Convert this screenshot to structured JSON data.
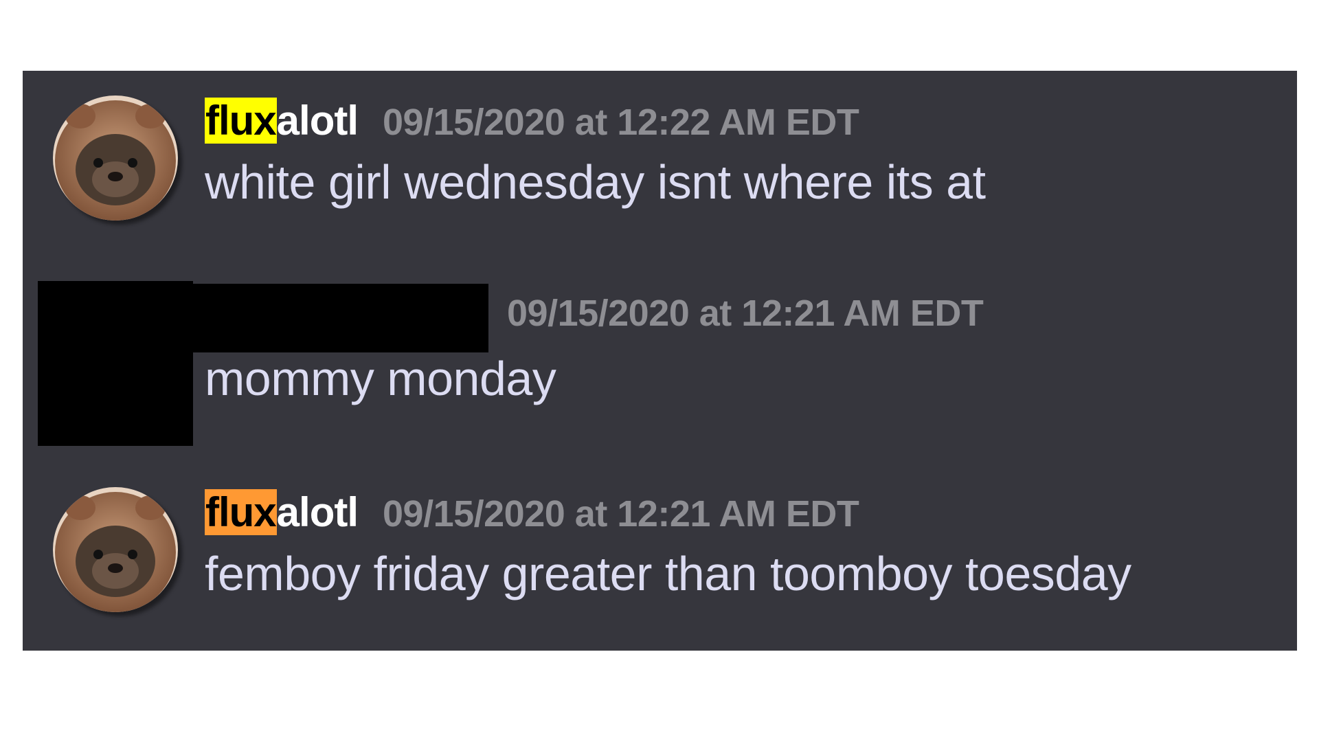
{
  "colors": {
    "panel_bg": "#36363d",
    "username": "#ffffff",
    "timestamp": "#8e8e93",
    "message_text": "#dcdcf2",
    "highlight_1": "#ffff00",
    "highlight_2": "#ff9933"
  },
  "messages": [
    {
      "avatar_icon": "otter-avatar-icon",
      "username_highlight": "flux",
      "username_rest": "alotl",
      "highlight_color": "#ffff00",
      "timestamp": "09/15/2020 at 12:22 AM EDT",
      "text": "white girl wednesday isnt where its at"
    },
    {
      "avatar_icon": "redacted-avatar",
      "username_highlight": "",
      "username_rest": "",
      "timestamp": "09/15/2020 at 12:21 AM EDT",
      "text": "mommy monday"
    },
    {
      "avatar_icon": "otter-avatar-icon",
      "username_highlight": "flux",
      "username_rest": "alotl",
      "highlight_color": "#ff9933",
      "timestamp": "09/15/2020 at 12:21 AM EDT",
      "text": "femboy friday greater than toomboy toesday"
    }
  ]
}
